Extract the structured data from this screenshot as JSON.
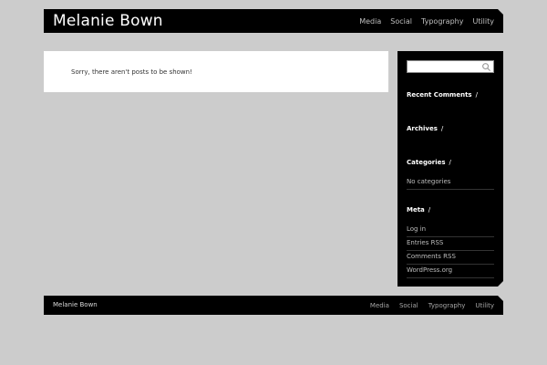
{
  "header": {
    "site_title": "Melanie Bown",
    "nav": [
      "Media",
      "Social",
      "Typography",
      "Utility"
    ]
  },
  "main": {
    "message": "Sorry, there aren't posts to be shown!"
  },
  "sidebar": {
    "search": {
      "placeholder": "",
      "icon": "search-icon"
    },
    "recent_comments": {
      "title": "Recent Comments",
      "slash": "/"
    },
    "archives": {
      "title": "Archives",
      "slash": "/"
    },
    "categories": {
      "title": "Categories",
      "slash": "/",
      "items": [
        "No categories"
      ]
    },
    "meta": {
      "title": "Meta",
      "slash": "/",
      "items": [
        "Log in",
        "Entries RSS",
        "Comments RSS",
        "WordPress.org"
      ]
    }
  },
  "footer": {
    "site_name": "Melanie Bown",
    "nav": [
      "Media",
      "Social",
      "Typography",
      "Utility"
    ]
  },
  "colors": {
    "background": "#cccccc",
    "bar": "#000000",
    "panel": "#ffffff"
  }
}
